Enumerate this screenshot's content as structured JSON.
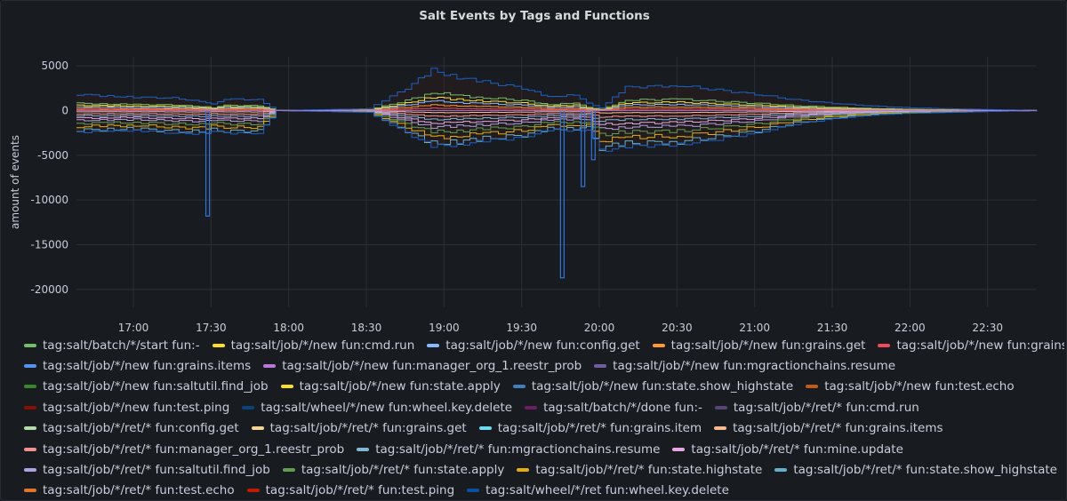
{
  "panel": {
    "title": "Salt Events by Tags and Functions"
  },
  "chart_data": {
    "type": "line",
    "title": "Salt Events by Tags and Functions",
    "ylabel": "amount of events",
    "xlabel": "",
    "ylim": [
      -22000,
      6000
    ],
    "yticks": [
      5000,
      0,
      -5000,
      -10000,
      -15000,
      -20000
    ],
    "xticks": [
      "17:00",
      "17:30",
      "18:00",
      "18:30",
      "19:00",
      "19:30",
      "20:00",
      "20:30",
      "21:00",
      "21:30",
      "22:00",
      "22:30"
    ],
    "xrange": [
      "16:38",
      "22:49"
    ],
    "grid": true,
    "legend_position": "bottom",
    "envelope": {
      "x": [
        "16:38",
        "16:50",
        "17:00",
        "17:15",
        "17:28",
        "17:30",
        "17:35",
        "17:48",
        "17:55",
        "18:30",
        "18:45",
        "18:55",
        "19:05",
        "19:15",
        "19:30",
        "19:40",
        "19:50",
        "19:55",
        "20:00",
        "20:10",
        "20:30",
        "20:45",
        "21:00",
        "21:15",
        "21:30",
        "21:45",
        "22:00",
        "22:30",
        "22:49"
      ],
      "upper": [
        1800,
        1600,
        1500,
        1400,
        900,
        700,
        1300,
        1200,
        0,
        200,
        2500,
        4500,
        3700,
        3200,
        2500,
        1500,
        1800,
        800,
        300,
        2600,
        2800,
        2300,
        1800,
        1200,
        800,
        500,
        300,
        100,
        0
      ],
      "lower": [
        -2400,
        -2300,
        -2200,
        -2500,
        -2600,
        -2300,
        -2500,
        -2500,
        0,
        -200,
        -2500,
        -4000,
        -3800,
        -3400,
        -3000,
        -2200,
        -2200,
        -2100,
        -4500,
        -4000,
        -3800,
        -3200,
        -2500,
        -1500,
        -900,
        -500,
        -300,
        -100,
        0
      ]
    },
    "spikes": [
      {
        "x": "17:28",
        "y": -11800
      },
      {
        "x": "19:45",
        "y": -18700
      },
      {
        "x": "19:53",
        "y": -8500
      },
      {
        "x": "19:57",
        "y": -5500
      }
    ],
    "series": [
      {
        "name": "tag:salt/batch/*/start fun:-",
        "color": "#73bf69"
      },
      {
        "name": "tag:salt/job/*/new fun:cmd.run",
        "color": "#fade2a"
      },
      {
        "name": "tag:salt/job/*/new fun:config.get",
        "color": "#8ab8ff"
      },
      {
        "name": "tag:salt/job/*/new fun:grains.get",
        "color": "#ff9830"
      },
      {
        "name": "tag:salt/job/*/new fun:grains.item",
        "color": "#f2495c"
      },
      {
        "name": "tag:salt/job/*/new fun:grains.items",
        "color": "#5794f2"
      },
      {
        "name": "tag:salt/job/*/new fun:manager_org_1.reestr_prob",
        "color": "#b877d9"
      },
      {
        "name": "tag:salt/job/*/new fun:mgractionchains.resume",
        "color": "#705da0"
      },
      {
        "name": "tag:salt/job/*/new fun:saltutil.find_job",
        "color": "#37872d"
      },
      {
        "name": "tag:salt/job/*/new fun:state.apply",
        "color": "#fade2a"
      },
      {
        "name": "tag:salt/job/*/new fun:state.show_highstate",
        "color": "#447ebc"
      },
      {
        "name": "tag:salt/job/*/new fun:test.echo",
        "color": "#c15c17"
      },
      {
        "name": "tag:salt/job/*/new fun:test.ping",
        "color": "#890f02"
      },
      {
        "name": "tag:salt/wheel/*/new fun:wheel.key.delete",
        "color": "#0a437c"
      },
      {
        "name": "tag:salt/batch/*/done fun:-",
        "color": "#6d1f62"
      },
      {
        "name": "tag:salt/job/*/ret/* fun:cmd.run",
        "color": "#584477"
      },
      {
        "name": "tag:salt/job/*/ret/* fun:config.get",
        "color": "#b7dbab"
      },
      {
        "name": "tag:salt/job/*/ret/* fun:grains.get",
        "color": "#f4d598"
      },
      {
        "name": "tag:salt/job/*/ret/* fun:grains.item",
        "color": "#70dbed"
      },
      {
        "name": "tag:salt/job/*/ret/* fun:grains.items",
        "color": "#f9ba8f"
      },
      {
        "name": "tag:salt/job/*/ret/* fun:manager_org_1.reestr_prob",
        "color": "#f29191"
      },
      {
        "name": "tag:salt/job/*/ret/* fun:mgractionchains.resume",
        "color": "#82b5d8"
      },
      {
        "name": "tag:salt/job/*/ret/* fun:mine.update",
        "color": "#e5a8e2"
      },
      {
        "name": "tag:salt/job/*/ret/* fun:saltutil.find_job",
        "color": "#aea2e0"
      },
      {
        "name": "tag:salt/job/*/ret/* fun:state.apply",
        "color": "#629e51"
      },
      {
        "name": "tag:salt/job/*/ret/* fun:state.highstate",
        "color": "#e5ac0e"
      },
      {
        "name": "tag:salt/job/*/ret/* fun:state.show_highstate",
        "color": "#64b0c8"
      },
      {
        "name": "tag:salt/job/*/ret/* fun:test.echo",
        "color": "#e0752d"
      },
      {
        "name": "tag:salt/job/*/ret/* fun:test.ping",
        "color": "#bf1b00"
      },
      {
        "name": "tag:salt/wheel/*/ret fun:wheel.key.delete",
        "color": "#0a50a1"
      }
    ],
    "series_fractions": [
      0.45,
      0.33,
      0.24,
      0.14,
      0.06,
      -0.06,
      -0.16,
      -0.25,
      -0.35,
      -0.46,
      -0.6,
      -0.75,
      -0.92
    ]
  },
  "legend_rows": [
    5,
    3,
    4,
    4,
    4,
    3,
    4,
    3
  ]
}
